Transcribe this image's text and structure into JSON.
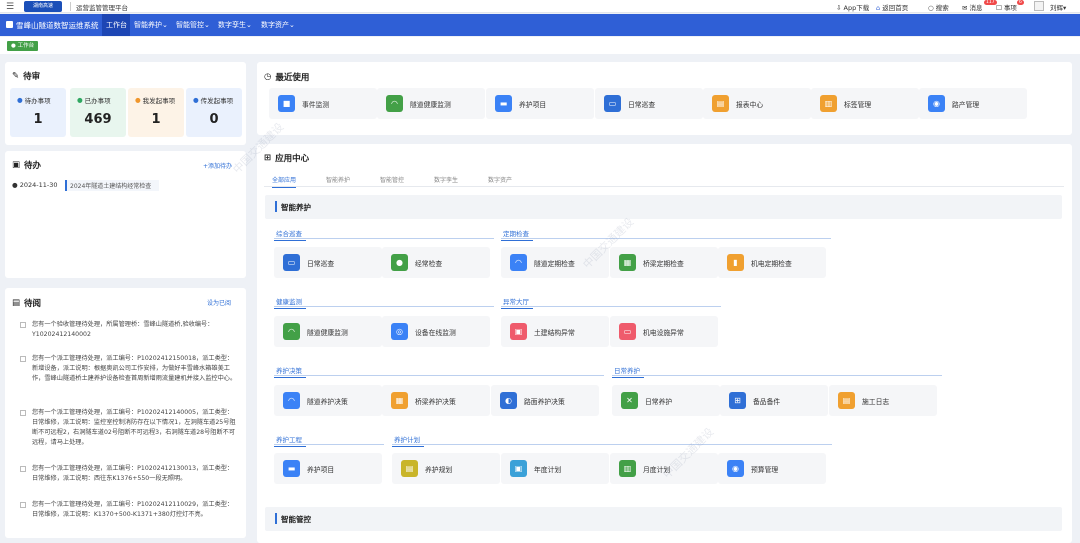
{
  "topbar": {
    "system_title": "运营监管管理平台",
    "logo_text": "湖南高速",
    "right_items": [
      "App下载",
      "返回首页",
      "搜索",
      "消息",
      "事项",
      "刘辉"
    ],
    "badges": [
      "117",
      "6"
    ]
  },
  "nav": {
    "brand": "雪峰山隧道数智运维系统",
    "items": [
      "工作台",
      "智能养护",
      "智能管控",
      "数字孪生",
      "数字资产"
    ]
  },
  "tags": {
    "active": "工作台"
  },
  "pending": {
    "title": "待审",
    "stats": [
      {
        "label": "待办事项",
        "value": "1"
      },
      {
        "label": "已办事项",
        "value": "469"
      },
      {
        "label": "我发起事项",
        "value": "1"
      },
      {
        "label": "传发起事项",
        "value": "0"
      }
    ]
  },
  "todo": {
    "title": "待办",
    "add_label": "添加待办",
    "items": [
      {
        "date": "2024-11-30",
        "text": "2024年隧道土建结构经常检查"
      }
    ]
  },
  "toread": {
    "title": "待阅",
    "mark_label": "设为已阅",
    "messages": [
      "您有一个验收管理待处理，所属管理桥：雪峰山隧道桥,验收编号：Y10202412140002",
      "您有一个派工管理待处理，派工编号：P10202412150018，派工类型：新增设备，派工说明：根据奥凯公司工作安排，为做好丰雪峰水箱雄美工作，雪峰山隧道桥土建养护设备检查首周新增雨流量建机并接入监控中心。",
      "您有一个派工管理待处理，派工编号：P10202412140005，派工类型：日常维修，派工说明：监控室控制消防存在以下情况1，左洞隧车道25号阻断不可远程2，右洞隧车道02号阻断不可远程3，右洞隧车道28号阻断不可远程，请马上处理。",
      "您有一个派工管理待处理，派工编号：P10202412130013，派工类型：日常维修，派工说明：西往东K1376+550一段无照明。",
      "您有一个派工管理待处理，派工编号：P10202412110029，派工类型：日常维修，派工说明：K1370+500-K1371+380灯控灯不亮。"
    ]
  },
  "recent": {
    "title": "最近使用",
    "items": [
      "事件监测",
      "隧道健康监测",
      "养护项目",
      "日常巡查",
      "报表中心",
      "标签管理",
      "路产管理"
    ]
  },
  "appcenter": {
    "title": "应用中心",
    "tabs": [
      "全部应用",
      "智能养护",
      "智能管控",
      "数字孪生",
      "数字资产"
    ],
    "smart_maint": "智能养护",
    "groups": [
      {
        "name": "综合巡查",
        "items": [
          "日常巡查",
          "经常检查"
        ]
      },
      {
        "name": "定期检查",
        "items": [
          "隧道定期检查",
          "桥梁定期检查",
          "机电定期检查"
        ]
      },
      {
        "name": "健康监测",
        "items": [
          "隧道健康监测",
          "设备在线监测"
        ]
      },
      {
        "name": "异常大厅",
        "items": [
          "土建结构异常",
          "机电设施异常"
        ]
      },
      {
        "name": "养护决策",
        "items": [
          "隧道养护决策",
          "桥梁养护决策",
          "路面养护决策"
        ]
      },
      {
        "name": "日常养护",
        "items": [
          "日常养护",
          "备品备件",
          "施工日志"
        ]
      },
      {
        "name": "养护工程",
        "items": [
          "养护项目"
        ]
      },
      {
        "name": "养护计划",
        "items": [
          "养护规划",
          "年度计划",
          "月度计划",
          "预算管理"
        ]
      }
    ],
    "smart_ctrl": "智能管控"
  },
  "watermark": "中国交通建设",
  "colors": {
    "nav": "#2f5fd6",
    "accent": "#2f6fd6",
    "green": "#4caf50"
  }
}
